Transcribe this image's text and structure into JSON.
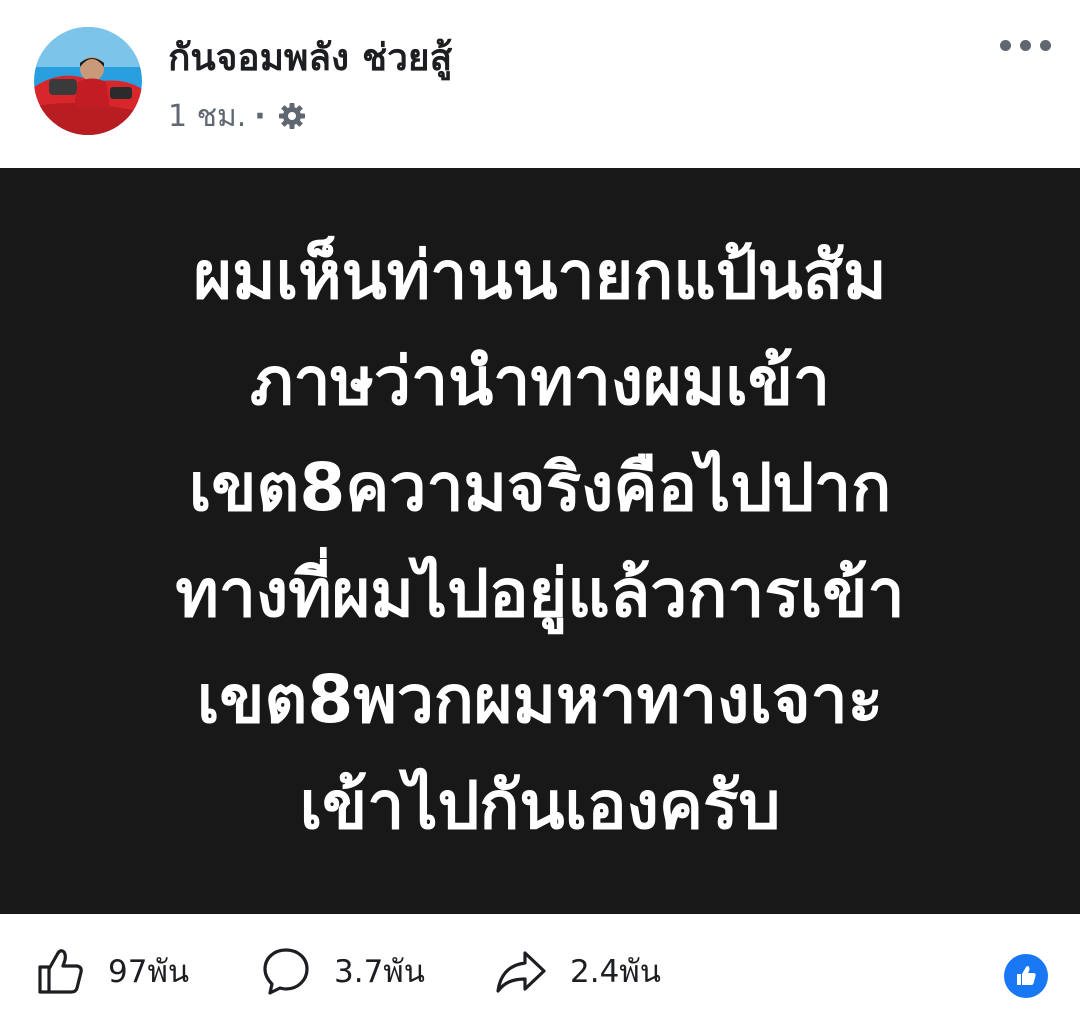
{
  "post": {
    "author": "กันจอมพลัง ช่วยสู้",
    "time": "1 ชม.",
    "separator": "·",
    "privacy_icon": "gear-icon",
    "more_icon": "more-options-icon",
    "content_lines": [
      "ผมเห็นท่านนายกแป้นสัม",
      "ภาษว่านำทางผมเข้า",
      "เขต8ความจริงคือไปปาก",
      "ทางที่ผมไปอยู่แล้วการเข้า",
      "เขต8พวกผมหาทางเจาะ",
      "เข้าไปกันเองครับ"
    ]
  },
  "stats": {
    "likes": "97พัน",
    "comments": "3.7พัน",
    "shares": "2.4พัน"
  },
  "colors": {
    "content_background": "#181818",
    "content_text": "#ffffff",
    "meta_gray": "#606770",
    "like_blue": "#1877f2"
  }
}
